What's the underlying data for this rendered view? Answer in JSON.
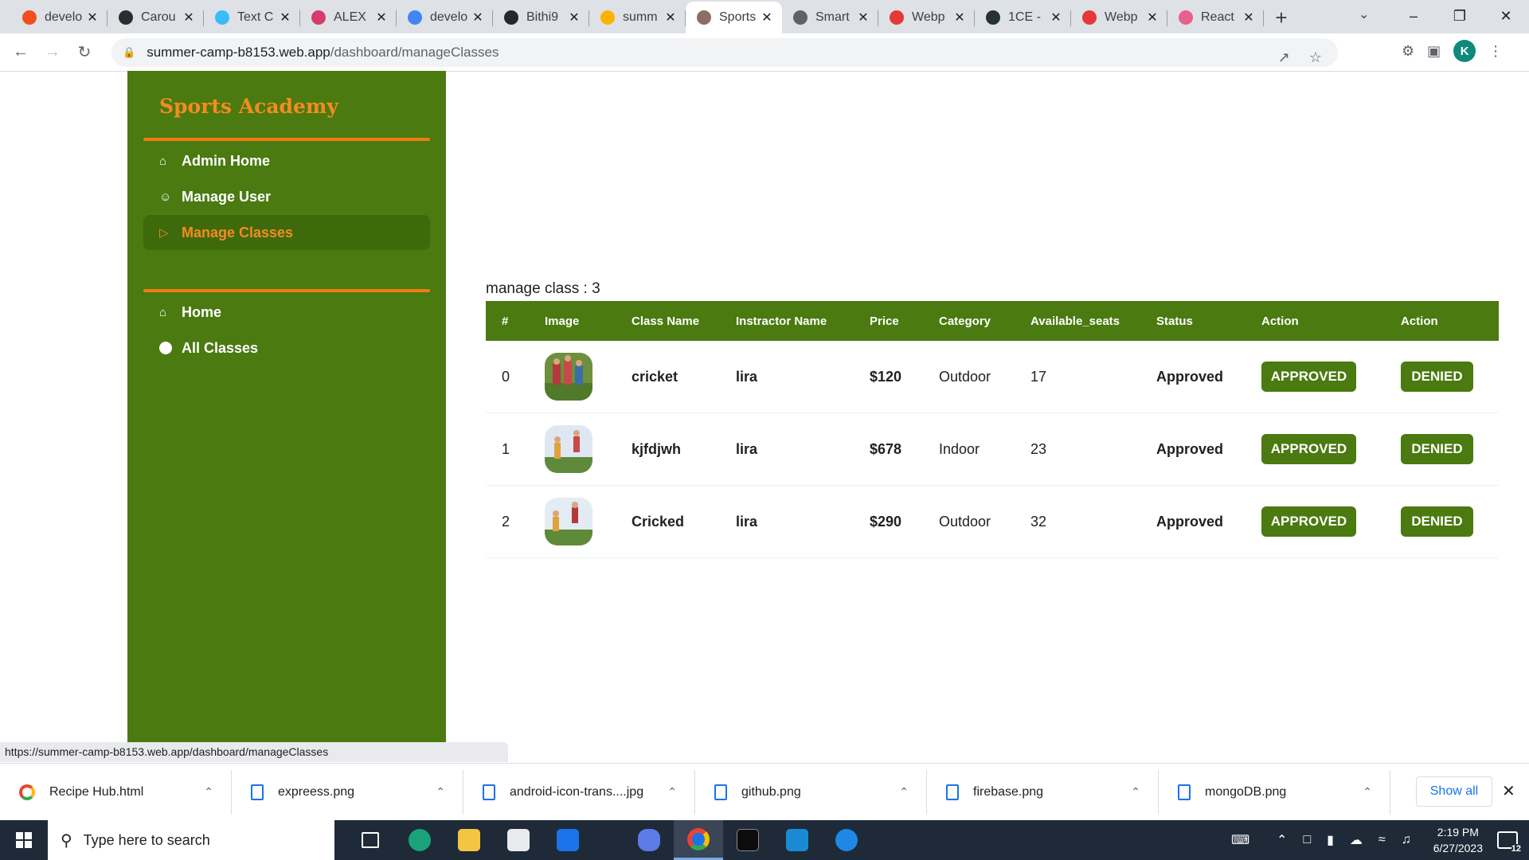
{
  "browser": {
    "tabs": [
      {
        "title": "develo",
        "color": "#f24e1e"
      },
      {
        "title": "Carou",
        "color": "#2d2d2d"
      },
      {
        "title": "Text C",
        "color": "#38bdf8"
      },
      {
        "title": "ALEX",
        "color": "#d63b6c"
      },
      {
        "title": "develo",
        "color": "#4285f4"
      },
      {
        "title": "Bithi9",
        "color": "#24292f"
      },
      {
        "title": "summ",
        "color": "#ffb300"
      },
      {
        "title": "Sports",
        "color": "#8d6e63",
        "active": true
      },
      {
        "title": "Smart",
        "color": "#5f6368"
      },
      {
        "title": "Webp",
        "color": "#e53935"
      },
      {
        "title": "1CE -",
        "color": "#263238"
      },
      {
        "title": "Webp",
        "color": "#e53935"
      },
      {
        "title": "React",
        "color": "#e8618c"
      }
    ],
    "url_host": "summer-camp-b8153.web.app",
    "url_path": "/dashboard/manageClasses",
    "profile_initial": "K",
    "status_url": "https://summer-camp-b8153.web.app/dashboard/manageClasses"
  },
  "sidebar": {
    "brand": "Sports Academy",
    "items": [
      {
        "label": "Admin Home",
        "icon": "home-icon"
      },
      {
        "label": "Manage User",
        "icon": "users-icon"
      },
      {
        "label": "Manage Classes",
        "icon": "play-icon",
        "active": true
      }
    ],
    "bottom_items": [
      {
        "label": "Home",
        "icon": "home-icon"
      },
      {
        "label": "All Classes",
        "icon": "circle-icon"
      }
    ]
  },
  "main": {
    "count_label": "manage class : 3",
    "headers": [
      "#",
      "Image",
      "Class Name",
      "Instractor Name",
      "Price",
      "Category",
      "Available_seats",
      "Status",
      "Action",
      "Action"
    ],
    "rows": [
      {
        "index": "0",
        "class_name": "cricket",
        "instructor": "lira",
        "price": "$120",
        "category": "Outdoor",
        "seats": "17",
        "status": "Approved",
        "approve": "APPROVED",
        "deny": "DENIED"
      },
      {
        "index": "1",
        "class_name": "kjfdjwh",
        "instructor": "lira",
        "price": "$678",
        "category": "Indoor",
        "seats": "23",
        "status": "Approved",
        "approve": "APPROVED",
        "deny": "DENIED"
      },
      {
        "index": "2",
        "class_name": "Cricked",
        "instructor": "lira",
        "price": "$290",
        "category": "Outdoor",
        "seats": "32",
        "status": "Approved",
        "approve": "APPROVED",
        "deny": "DENIED"
      }
    ]
  },
  "downloads": {
    "items": [
      "Recipe Hub.html",
      "expreess.png",
      "android-icon-trans....jpg",
      "github.png",
      "firebase.png",
      "mongoDB.png"
    ],
    "show_all": "Show all"
  },
  "taskbar": {
    "search_placeholder": "Type here to search",
    "time": "2:19 PM",
    "date": "6/27/2023",
    "notifications": "12"
  },
  "colors": {
    "sidebar": "#4a7a10",
    "accent": "#f58b1f",
    "button": "#4a7a10"
  }
}
